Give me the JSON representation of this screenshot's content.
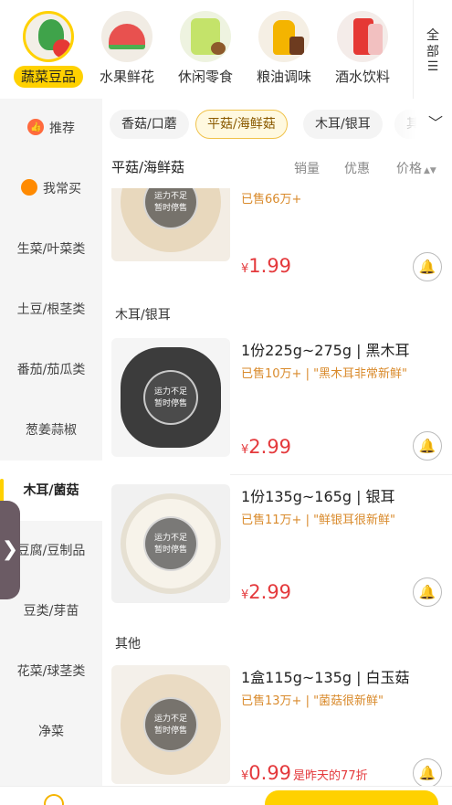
{
  "top_categories": [
    {
      "label": "蔬菜豆品",
      "icon": "vegetable-icon",
      "active": true
    },
    {
      "label": "水果鲜花",
      "icon": "watermelon-icon",
      "active": false
    },
    {
      "label": "休闲零食",
      "icon": "snack-icon",
      "active": false
    },
    {
      "label": "粮油调味",
      "icon": "oil-icon",
      "active": false
    },
    {
      "label": "酒水饮料",
      "icon": "drink-can-icon",
      "active": false
    }
  ],
  "all_button": {
    "line1": "全",
    "line2": "部",
    "icon": "menu-icon"
  },
  "sidebar": {
    "items": [
      {
        "label": "推荐",
        "icon": "thumbs-up-icon"
      },
      {
        "label": "我常买",
        "icon": "shopping-bag-icon"
      },
      {
        "label": "生菜/叶菜类"
      },
      {
        "label": "土豆/根茎类"
      },
      {
        "label": "番茄/茄瓜类"
      },
      {
        "label": "葱姜蒜椒"
      },
      {
        "label": "木耳/菌菇",
        "active": true
      },
      {
        "label": "豆腐/豆制品"
      },
      {
        "label": "豆类/芽苗"
      },
      {
        "label": "花菜/球茎类"
      },
      {
        "label": "净菜"
      }
    ],
    "pull_tab_glyph": "❯"
  },
  "subtabs": {
    "chips": [
      "香菇/口蘑",
      "平菇/海鲜菇",
      "木耳/银耳",
      "其"
    ],
    "active_index": 1,
    "expand_glyph": "﹀"
  },
  "sort_row": {
    "title": "平菇/海鲜菇",
    "options": [
      "销量",
      "优惠",
      "价格"
    ],
    "price_arrows": "▲▼"
  },
  "stock_stamp": {
    "line1": "运力不足",
    "line2": "暂时停售"
  },
  "products": [
    {
      "sold": "已售66万+",
      "price_symbol": "¥",
      "price": "1.99",
      "bell_icon": "bell-icon"
    },
    {
      "section": "木耳/银耳",
      "name": "1份225g~275g | 黑木耳",
      "sold": "已售10万+ | \"黑木耳非常新鲜\"",
      "price_symbol": "¥",
      "price": "2.99"
    },
    {
      "name": "1份135g~165g | 银耳",
      "sold": "已售11万+ | \"鲜银耳很新鲜\"",
      "price_symbol": "¥",
      "price": "2.99"
    },
    {
      "section": "其他",
      "name": "1盒115g~135g | 白玉菇",
      "sold": "已售13万+ | \"菌菇很新鲜\"",
      "price_symbol": "¥",
      "price": "0.99",
      "price_note": "是昨天的77折"
    }
  ],
  "colors": {
    "accent_yellow": "#ffd100",
    "price_red": "#e4393c",
    "sold_orange": "#d98a2b",
    "sidebar_bg": "#f5f5f5"
  }
}
